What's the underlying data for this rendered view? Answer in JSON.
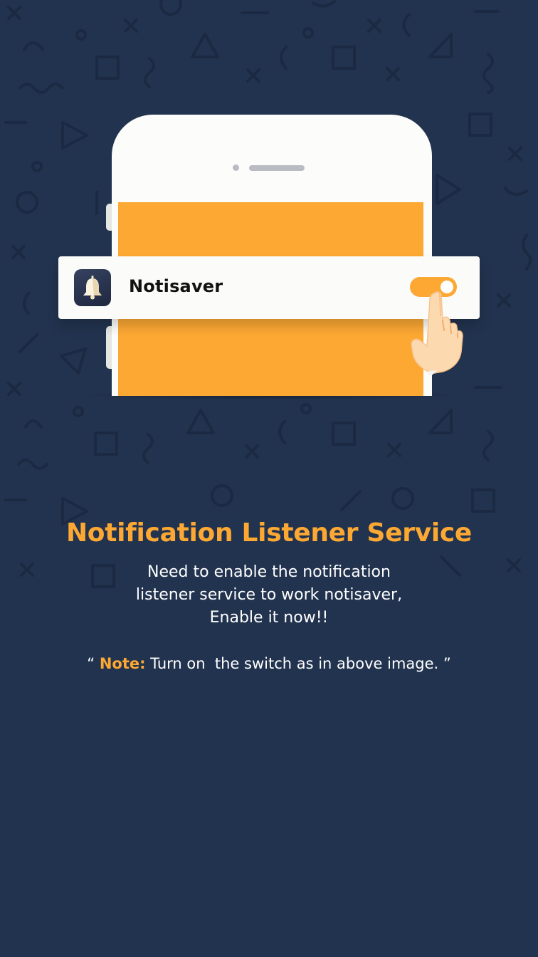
{
  "app": {
    "name": "Notisaver",
    "icon": "bell-icon",
    "toggle_state": "on"
  },
  "colors": {
    "background": "#22334f",
    "accent": "#fca833",
    "text": "#ffffff"
  },
  "content": {
    "title": "Notification Listener Service",
    "description_lines": [
      "Need to enable the notification",
      "listener service to work notisaver,",
      "Enable it now!!"
    ],
    "note_open_quote": "“ ",
    "note_label": "Note:",
    "note_text": " Turn on  the switch as in above image. ”"
  }
}
